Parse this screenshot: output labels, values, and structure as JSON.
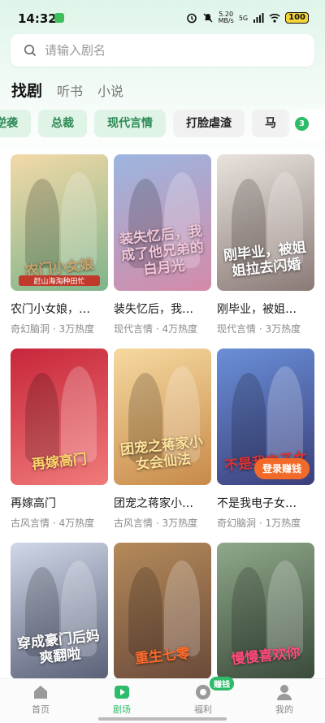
{
  "status_bar": {
    "time": "14:32",
    "net_speed": "5.20\nMB/s",
    "network": "5G",
    "battery": "100"
  },
  "search": {
    "placeholder": "请输入剧名"
  },
  "main_tabs": [
    {
      "label": "找剧",
      "active": true
    },
    {
      "label": "听书",
      "active": false
    },
    {
      "label": "小说",
      "active": false
    }
  ],
  "tags": [
    {
      "label": "逆袭",
      "style": "green"
    },
    {
      "label": "总裁",
      "style": "green"
    },
    {
      "label": "现代言情",
      "style": "green"
    },
    {
      "label": "打脸虐渣",
      "style": "gray"
    },
    {
      "label": "马",
      "style": "gray"
    }
  ],
  "tag_count": "3",
  "cards": [
    {
      "title": "农门小女娘，…",
      "genre": "奇幻脑洞",
      "heat": "3万热度",
      "poster_text": "农门小女娘",
      "poster_sub": "赶山海淘种田忙",
      "c1": "#f3d9a8",
      "c2": "#7fb48a",
      "accent": "#c9a36a"
    },
    {
      "title": "装失忆后，我…",
      "genre": "现代言情",
      "heat": "4万热度",
      "poster_text": "装失忆后，我成了他兄弟的白月光",
      "poster_sub": "",
      "c1": "#9bb6e0",
      "c2": "#d48aa8",
      "accent": "#f2c6d8"
    },
    {
      "title": "刚毕业，被姐…",
      "genre": "现代言情",
      "heat": "3万热度",
      "poster_text": "刚毕业，被姐姐拉去闪婚",
      "poster_sub": "",
      "c1": "#e9e3dd",
      "c2": "#8a7a76",
      "accent": "#ffffff"
    },
    {
      "title": "再嫁高门",
      "genre": "古风言情",
      "heat": "4万热度",
      "poster_text": "再嫁高门",
      "poster_sub": "",
      "c1": "#c7263a",
      "c2": "#f07a7a",
      "accent": "#ffd66b"
    },
    {
      "title": "团宠之蒋家小…",
      "genre": "古风言情",
      "heat": "3万热度",
      "poster_text": "团宠之蒋家小女会仙法",
      "poster_sub": "",
      "c1": "#f6d9a0",
      "c2": "#c78a4a",
      "accent": "#ffe39a"
    },
    {
      "title": "不是我电子女…",
      "genre": "奇幻脑洞",
      "heat": "1万热度",
      "poster_text": "不是我电子女",
      "poster_sub": "",
      "c1": "#6a8fd8",
      "c2": "#3b3f7a",
      "accent": "#d33"
    },
    {
      "title": "",
      "genre": "",
      "heat": "",
      "poster_text": "穿成豪门后妈爽翻啦",
      "poster_sub": "",
      "c1": "#cfd7e8",
      "c2": "#5a6178",
      "accent": "#fff"
    },
    {
      "title": "",
      "genre": "",
      "heat": "",
      "poster_text": "重生七零",
      "poster_sub": "",
      "c1": "#b58a5a",
      "c2": "#6a4a3a",
      "accent": "#ff6a2a"
    },
    {
      "title": "",
      "genre": "",
      "heat": "",
      "poster_text": "慢慢喜欢你",
      "poster_sub": "",
      "c1": "#8fa88a",
      "c2": "#3a4a3a",
      "accent": "#ff4a7a"
    }
  ],
  "earn_button": "登录赚钱",
  "bottom_nav": [
    {
      "label": "首页",
      "icon": "home-icon",
      "active": false
    },
    {
      "label": "剧场",
      "icon": "play-icon",
      "active": true
    },
    {
      "label": "福利",
      "icon": "coin-icon",
      "active": false
    },
    {
      "label": "我的",
      "icon": "profile-icon",
      "active": false
    }
  ],
  "nav_badge": "赚钱",
  "colors": {
    "accent": "#2ebc6b",
    "tag_bg": "#dff3e6",
    "earn": "#f26a2a"
  }
}
